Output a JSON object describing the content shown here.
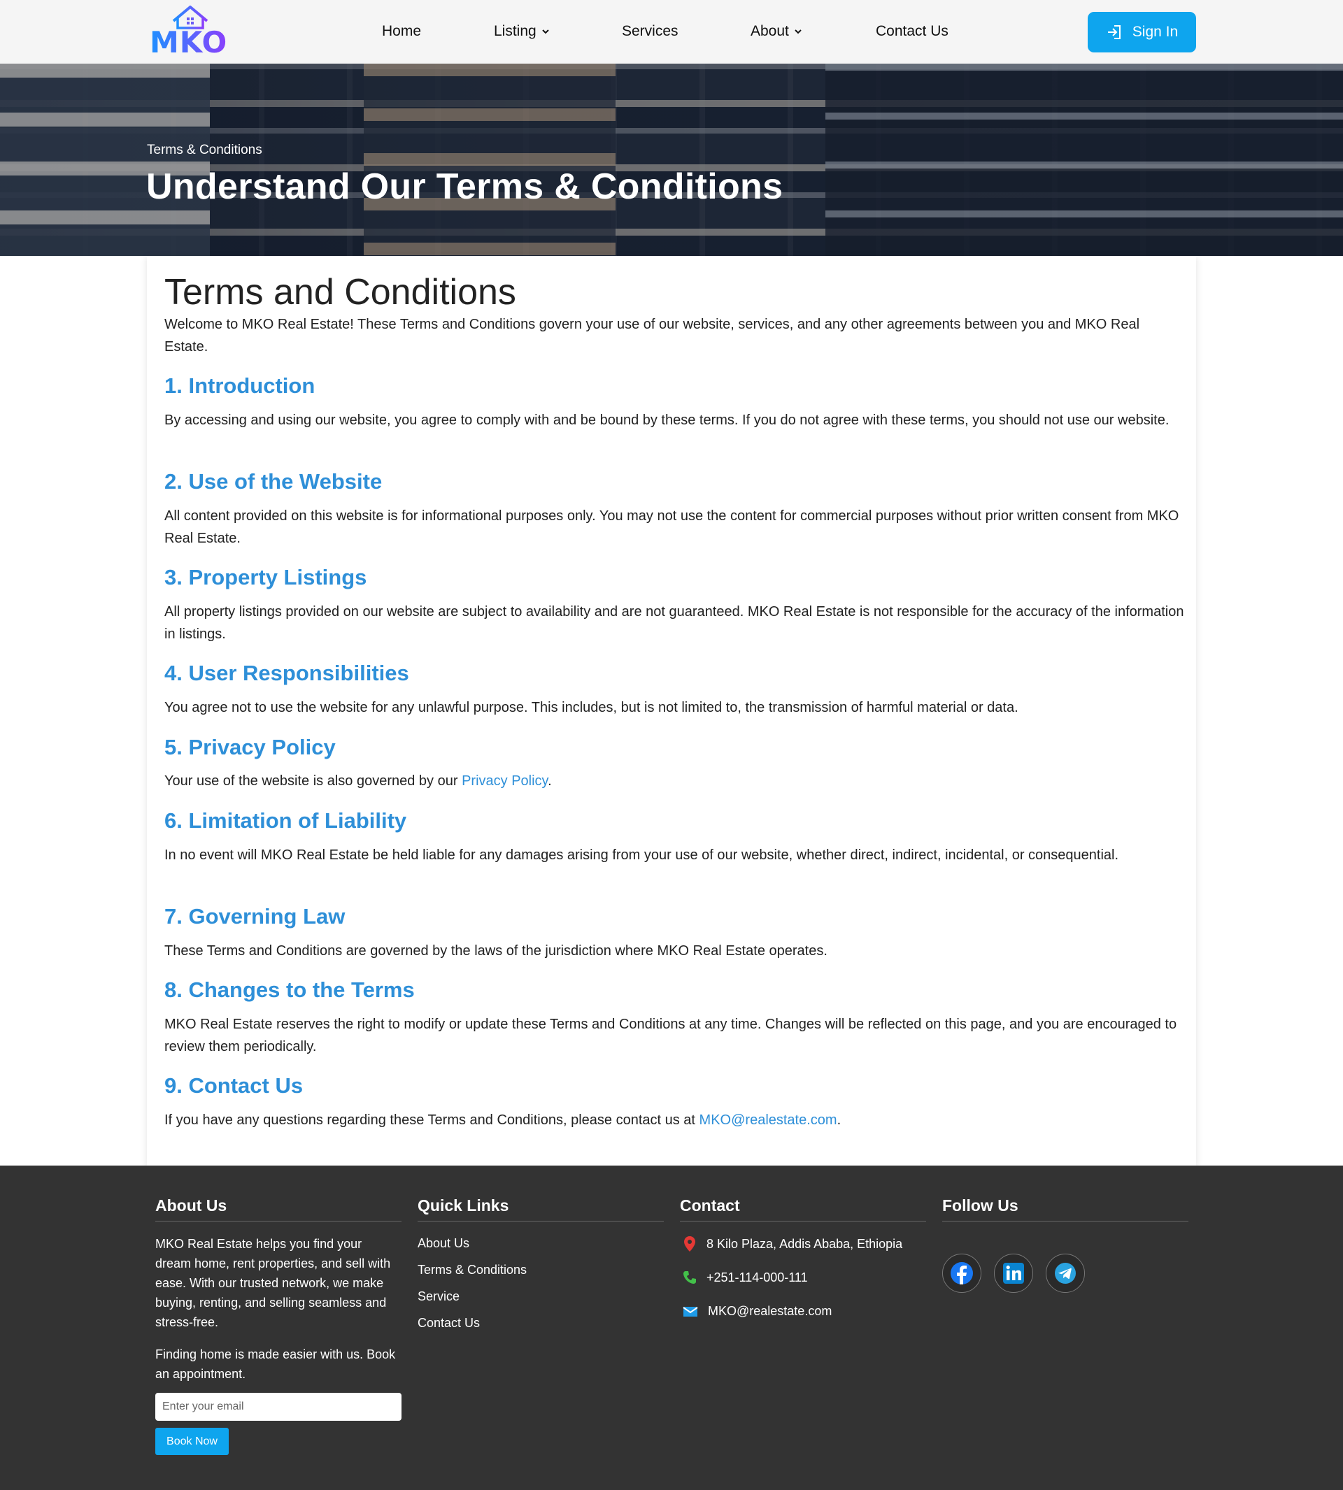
{
  "nav": {
    "logo_text": "MKO",
    "links": [
      "Home",
      "Listing",
      "Services",
      "About",
      "Contact Us"
    ],
    "signin_label": "Sign In"
  },
  "hero": {
    "breadcrumb": "Terms & Conditions",
    "title": "Understand Our Terms & Conditions"
  },
  "content": {
    "title": "Terms and Conditions",
    "intro": "Welcome to MKO Real Estate! These Terms and Conditions govern your use of our website, services, and any other agreements between you and MKO Real Estate.",
    "sections": [
      {
        "heading": "1. Introduction",
        "body": "By accessing and using our website, you agree to comply with and be bound by these terms. If you do not agree with these terms, you should not use our website."
      },
      {
        "heading": "2. Use of the Website",
        "body": "All content provided on this website is for informational purposes only. You may not use the content for commercial purposes without prior written consent from MKO Real Estate."
      },
      {
        "heading": "3. Property Listings",
        "body": "All property listings provided on our website are subject to availability and are not guaranteed. MKO Real Estate is not responsible for the accuracy of the information in listings."
      },
      {
        "heading": "4. User Responsibilities",
        "body": "You agree not to use the website for any unlawful purpose. This includes, but is not limited to, the transmission of harmful material or data."
      },
      {
        "heading": "5. Privacy Policy",
        "body_prefix": "Your use of the website is also governed by our ",
        "link": "Privacy Policy",
        "body_suffix": "."
      },
      {
        "heading": "6. Limitation of Liability",
        "body": "In no event will MKO Real Estate be held liable for any damages arising from your use of our website, whether direct, indirect, incidental, or consequential."
      },
      {
        "heading": "7. Governing Law",
        "body": "These Terms and Conditions are governed by the laws of the jurisdiction where MKO Real Estate operates."
      },
      {
        "heading": "8. Changes to the Terms",
        "body": "MKO Real Estate reserves the right to modify or update these Terms and Conditions at any time. Changes will be reflected on this page, and you are encouraged to review them periodically."
      },
      {
        "heading": "9. Contact Us",
        "body_prefix": "If you have any questions regarding these Terms and Conditions, please contact us at ",
        "link": "MKO@realestate.com",
        "body_suffix": "."
      }
    ]
  },
  "footer": {
    "about": {
      "heading": "About Us",
      "text1": "MKO Real Estate helps you find your dream home, rent properties, and sell with ease. With our trusted network, we make buying, renting, and selling seamless and stress-free.",
      "text2": "Finding home is made easier with us. Book an appointment.",
      "email_placeholder": "Enter your email",
      "button": "Book Now"
    },
    "quick_links": {
      "heading": "Quick Links",
      "items": [
        "About Us",
        "Terms & Conditions",
        "Service",
        "Contact Us"
      ]
    },
    "contact": {
      "heading": "Contact",
      "address": "8 Kilo Plaza, Addis Ababa, Ethiopia",
      "phone": "+251-114-000-111",
      "email": "MKO@realestate.com"
    },
    "follow": {
      "heading": "Follow Us",
      "icons": [
        "facebook-icon",
        "linkedin-icon",
        "telegram-icon"
      ]
    }
  },
  "colors": {
    "accent": "#0ea5ee",
    "heading_blue": "#2e8fd8",
    "footer_bg": "#333333",
    "nav_bg": "#f5f5f5"
  }
}
